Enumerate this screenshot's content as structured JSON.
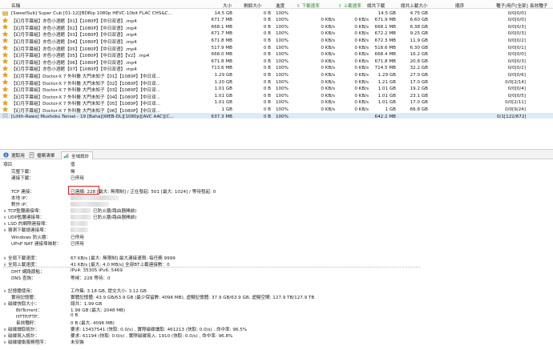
{
  "columns": {
    "name": "名稱",
    "size": "大小",
    "remaining": "剩餘大小",
    "progress": "進度",
    "down_speed": "下載速率",
    "up_speed": "上載速率",
    "downloaded": "總共下載",
    "uploaded": "總共上載大小",
    "seeds_peers": "種子/用戶[全部]",
    "sequence": "順序",
    "active_time": "長效種子"
  },
  "torrents": [
    {
      "name": "[SweetSub] Super Cub [01-12][BDRip 1080p HEVC-10bit FLAC CHS&C...",
      "size": "14.5 GB",
      "remaining": "0 B",
      "progress": "100%",
      "down": "",
      "up": "",
      "downloaded": "14.5 GB",
      "uploaded": "4.75 GB",
      "seeds": "0/0[0/0]",
      "icon": "folder"
    },
    {
      "name": "【幻月字幕組】亦色小酒館【01】【1080P】【中日双语】.mp4",
      "size": "671.7 MB",
      "remaining": "0 B",
      "progress": "100%",
      "down": "0 KB/s",
      "up": "0 KB/s",
      "downloaded": "671.9 MB",
      "uploaded": "6.60 GB",
      "seeds": "0/0[0/0]",
      "icon": "star"
    },
    {
      "name": "【幻月字幕組】亦色小酒館【02】【1080P】【中日双语】.mp4",
      "size": "668.1 MB",
      "remaining": "0 B",
      "progress": "100%",
      "down": "0 KB/s",
      "up": "0 KB/s",
      "downloaded": "668.1 MB",
      "uploaded": "6.38 GB",
      "seeds": "0/0[0/3]",
      "icon": "star"
    },
    {
      "name": "【幻月字幕組】亦色小酒館【03】【1080P】【中日双语】.mp4",
      "size": "671.7 MB",
      "remaining": "0 B",
      "progress": "100%",
      "down": "0 KB/s",
      "up": "0 KB/s",
      "downloaded": "672.2 MB",
      "uploaded": "9.25 GB",
      "seeds": "0/0[0/3]",
      "icon": "star"
    },
    {
      "name": "【幻月字幕組】亦色小酒館【04】【1080P】【中日双语】.mp4",
      "size": "671.8 MB",
      "remaining": "0 B",
      "progress": "100%",
      "down": "0 KB/s",
      "up": "0 KB/s",
      "downloaded": "672.3 MB",
      "uploaded": "11.9 GB",
      "seeds": "0/0[0/2]",
      "icon": "star"
    },
    {
      "name": "【幻月字幕組】亦色小酒館【05】【1080P】【中日双语】.mp4",
      "size": "517.9 MB",
      "remaining": "0 B",
      "progress": "100%",
      "down": "0 KB/s",
      "up": "0 KB/s",
      "downloaded": "518.6 MB",
      "uploaded": "6.30 GB",
      "seeds": "0/0[0/1]",
      "icon": "star"
    },
    {
      "name": "【幻月字幕組】亦色小酒館【05】【1080P】【中日双语】【V2】.mp4",
      "size": "668.0 MB",
      "remaining": "0 B",
      "progress": "100%",
      "down": "0 KB/s",
      "up": "0 KB/s",
      "downloaded": "668.4 MB",
      "uploaded": "16.2 GB",
      "seeds": "0/0[0/0]",
      "icon": "star"
    },
    {
      "name": "【幻月字幕組】亦色小酒館【06】【1080P】【中日双语】.mp4",
      "size": "671.8 MB",
      "remaining": "0 B",
      "progress": "100%",
      "down": "0 KB/s",
      "up": "0 KB/s",
      "downloaded": "671.8 MB",
      "uploaded": "20.8 GB",
      "seeds": "0/0[0/3]",
      "icon": "star"
    },
    {
      "name": "【幻月字幕組】亦色小酒館【07】【1080P】【中日双语】.mp4",
      "size": "713.6 MB",
      "remaining": "0 B",
      "progress": "100%",
      "down": "0 KB/s",
      "up": "0 KB/s",
      "downloaded": "714.5 MB",
      "uploaded": "32.2 GB",
      "seeds": "0/0[0/2]",
      "icon": "star"
    },
    {
      "name": "【幻月字幕組】Doctor-X 7 外科醫 大門未知子【01】【1080P】【中日双...",
      "size": "1.29 GB",
      "remaining": "0 B",
      "progress": "100%",
      "down": "0 KB/s",
      "up": "0 KB/s",
      "downloaded": "1.29 GB",
      "uploaded": "27.0 GB",
      "seeds": "0/0[0/6]",
      "icon": "star"
    },
    {
      "name": "【幻月字幕組】Doctor-X 7 外科醫 大門未知子【02】【1080P】【中日双...",
      "size": "1.20 GB",
      "remaining": "0 B",
      "progress": "100%",
      "down": "0 KB/s",
      "up": "0 KB/s",
      "downloaded": "1.21 GB",
      "uploaded": "17.0 GB",
      "seeds": "0/0[2/14]",
      "icon": "star"
    },
    {
      "name": "【幻月字幕組】Doctor-X 7 外科醫 大門未知子【03】【1080P】【中日双...",
      "size": "1.01 GB",
      "remaining": "0 B",
      "progress": "100%",
      "down": "0 KB/s",
      "up": "0 KB/s",
      "downloaded": "1.01 GB",
      "uploaded": "19.2 GB",
      "seeds": "0/0[0/4]",
      "icon": "star"
    },
    {
      "name": "【幻月字幕組】Doctor-X 7 外科醫 大門未知子【04】【1080P】【中日双...",
      "size": "1.01 GB",
      "remaining": "0 B",
      "progress": "100%",
      "down": "0 KB/s",
      "up": "0 KB/s",
      "downloaded": "1.01 GB",
      "uploaded": "23.1 GB",
      "seeds": "0/0[0/5]",
      "icon": "star"
    },
    {
      "name": "【幻月字幕組】Doctor-X 7 外科醫 大門未知子【05】【1080P】【中日双...",
      "size": "1.01 GB",
      "remaining": "0 B",
      "progress": "100%",
      "down": "0 KB/s",
      "up": "0 KB/s",
      "downloaded": "1.01 GB",
      "uploaded": "17.0 GB",
      "seeds": "0/0[2/11]",
      "icon": "star"
    },
    {
      "name": "【幻月字幕組】Doctor-X 7 外科醫 大門未知子【06】【1080P】【中日双...",
      "size": "1 GB",
      "remaining": "0 B",
      "progress": "100%",
      "down": "0 KB/s",
      "up": "0 KB/s",
      "downloaded": "1 GB",
      "uploaded": "66.8 GB",
      "seeds": "0/0[9/24]",
      "icon": "star"
    },
    {
      "name": "[Lilith-Raws] Mushoku Tensei - 19 [Baha][WEB-DL][1080p][AVC AAC][C...",
      "size": "637.3 MB",
      "remaining": "0 B",
      "progress": "100%",
      "down": "",
      "up": "",
      "downloaded": "642.2 MB",
      "uploaded": "",
      "seeds": "0/1[122/672]",
      "icon": "doc"
    }
  ],
  "tabs": [
    {
      "label": "選取用",
      "icon": "info-icon"
    },
    {
      "label": "檔案清單",
      "icon": "files-icon"
    },
    {
      "label": "全域統計",
      "icon": "stats-icon"
    }
  ],
  "stats": {
    "section": "項目",
    "section_val": "值",
    "rows": [
      {
        "label": "完整下載：",
        "value": "無"
      },
      {
        "label": "連接下載：",
        "value": "已停用"
      },
      {
        "label": "TCP 連接：",
        "value_pre": "已連線: 228",
        "value": " [最大: 無限制] / 正在發起: 501 [最大: 1024] / 等待發起: 0"
      },
      {
        "label": "本地 IP：",
        "value": ""
      },
      {
        "label": "對外 IP：",
        "value": ""
      },
      {
        "label": "TCP監聽連接埠：",
        "value": "已防火牆/路由器開啟)"
      },
      {
        "label": "UDP監聽連接埠：",
        "value": "已防火牆/路由器開啟)"
      },
      {
        "label": "LSD 的網際連接埠：",
        "value": ""
      },
      {
        "label": "猜測下載總連接埠：",
        "value": ""
      },
      {
        "label": "Windows 防火牆：",
        "value": "已停用"
      },
      {
        "label": "UPnP NAT 連接埠映射：",
        "value": "已停用"
      },
      {
        "label": "全局下載速度：",
        "value": "67 KB/s [最大: 無限制]   最大連接速限: 每任務 9999"
      },
      {
        "label": "全局上載速度：",
        "value": "41 KB/s [最大: 4.0 MB/s]   全部BT上載連接數：0"
      },
      {
        "label": "DHT 網路節點：",
        "value": "IPv4: 35305  IPv6: 5469"
      },
      {
        "label": "DNS 查詢：",
        "value": "等候：228   等待：0"
      },
      {
        "label": "記憶體使用：",
        "value": "工作集: 3.18 GB, 提交大小: 3.12 GB"
      },
      {
        "label": "實用記憶體：",
        "value": "實體記憶體: 43.9 GB/63.9 GB (最少保留數: 4096 MB), 虛擬記憶體: 37.9 GB/63.9 GB, 虛擬空間: 127.9 TB/127.9 TB"
      },
      {
        "label": "磁碟快取大小：",
        "value": "總共：1.99 GB"
      },
      {
        "label": "BitTorrent：",
        "value": "1.99 GB (最大: 2048 MB)"
      },
      {
        "label": "HTTP/FTP：",
        "value": "0 B"
      },
      {
        "label": "長效種籽：",
        "value": "0 B (最大: 4096 MB)"
      },
      {
        "label": "磁碟讀取統計：",
        "value": "要求: 13437541 (快取: 0.0/s) , 實際磁碟讀取: 461213 (快取: 0.0/s) , 命中率: 96.5%"
      },
      {
        "label": "磁碟寫入統計：",
        "value": "要求: 61194 (快取: 0.0/s) , 實際磁碟寫入: 1910 (快取: 0.0/s) , 命中率: 96.8%"
      },
      {
        "label": "磁碟緩衝服務程序：",
        "value": "未安裝"
      }
    ]
  },
  "colors": {
    "star": "#f0a000",
    "selected_row": "#dce9f7",
    "highlight_box": "#e02020",
    "folder": "#e8c060"
  }
}
